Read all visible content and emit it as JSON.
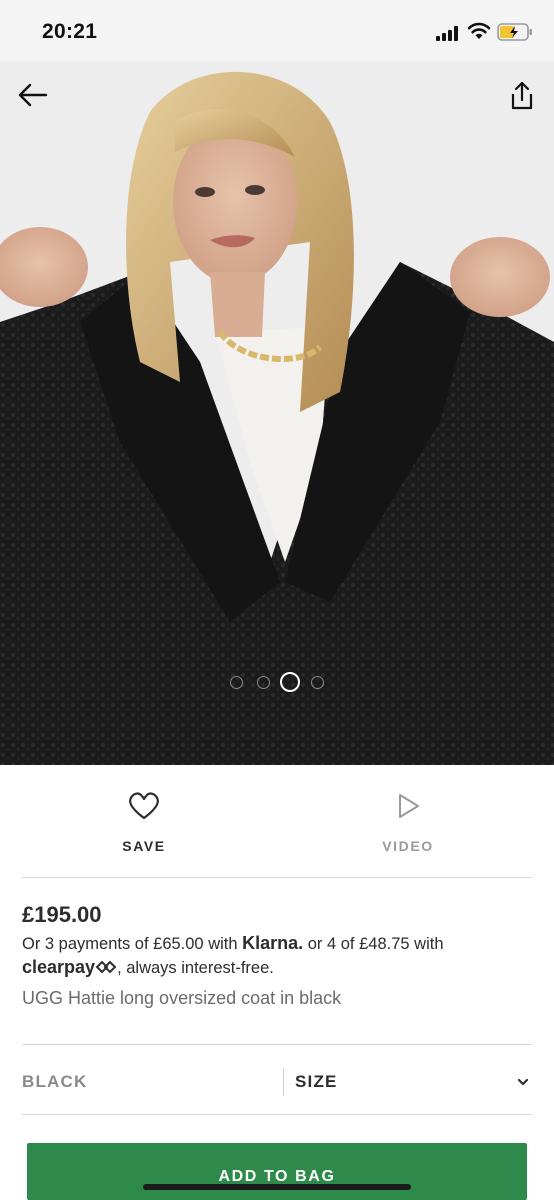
{
  "status_bar": {
    "time": "20:21"
  },
  "icons": {
    "back": "arrow-left-icon",
    "share": "share-icon",
    "save": "heart-icon",
    "video": "play-icon",
    "size_dropdown": "chevron-down-icon"
  },
  "gallery": {
    "image_count": 4,
    "active_index": 2
  },
  "actions": {
    "save_label": "SAVE",
    "video_label": "VIDEO"
  },
  "product": {
    "price": "£195.00",
    "installments_prefix": "Or 3 payments of £65.00 with ",
    "klarna": "Klarna.",
    "installments_middle": " or 4 of £48.75 with",
    "clearpay": "clearpay",
    "installments_suffix": ", always interest-free.",
    "name": "UGG Hattie long oversized coat in black"
  },
  "options": {
    "colour": "BLACK",
    "size_label": "SIZE"
  },
  "cta": {
    "add_to_bag": "ADD TO BAG"
  },
  "colors": {
    "accent_green": "#2e8a4a",
    "text_dark": "#2d2d2d",
    "text_muted": "#8a8a8a"
  }
}
